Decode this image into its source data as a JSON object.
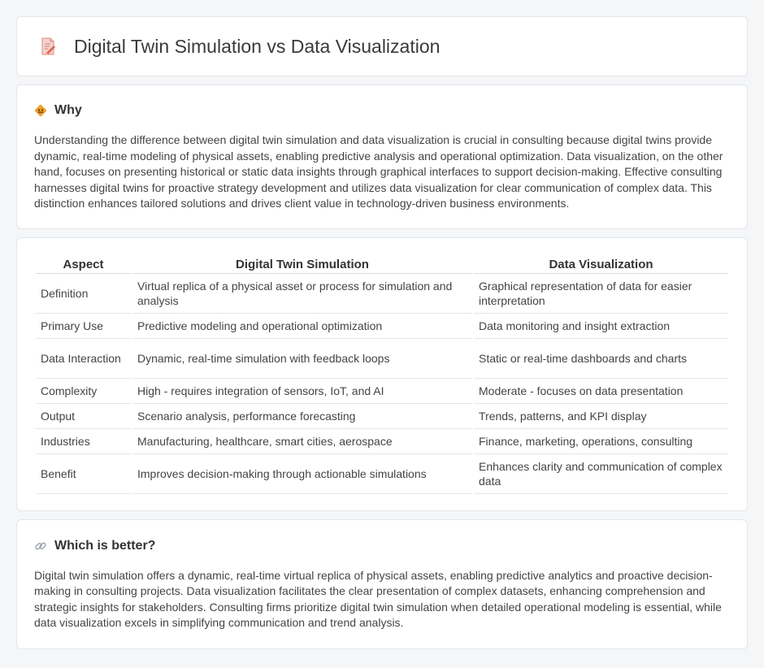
{
  "header": {
    "title": "Digital Twin Simulation vs Data Visualization",
    "icon": "document-pencil-icon"
  },
  "why": {
    "heading": "Why",
    "icon": "diamond-sign-icon",
    "text": "Understanding the difference between digital twin simulation and data visualization is crucial in consulting because digital twins provide dynamic, real-time modeling of physical assets, enabling predictive analysis and operational optimization. Data visualization, on the other hand, focuses on presenting historical or static data insights through graphical interfaces to support decision-making. Effective consulting harnesses digital twins for proactive strategy development and utilizes data visualization for clear communication of complex data. This distinction enhances tailored solutions and drives client value in technology-driven business environments."
  },
  "table": {
    "headers": [
      "Aspect",
      "Digital Twin Simulation",
      "Data Visualization"
    ],
    "rows": [
      [
        "Definition",
        "Virtual replica of a physical asset or process for simulation and analysis",
        "Graphical representation of data for easier interpretation"
      ],
      [
        "Primary Use",
        "Predictive modeling and operational optimization",
        "Data monitoring and insight extraction"
      ],
      [
        "Data Interaction",
        "Dynamic, real-time simulation with feedback loops",
        "Static or real-time dashboards and charts"
      ],
      [
        "Complexity",
        "High - requires integration of sensors, IoT, and AI",
        "Moderate - focuses on data presentation"
      ],
      [
        "Output",
        "Scenario analysis, performance forecasting",
        "Trends, patterns, and KPI display"
      ],
      [
        "Industries",
        "Manufacturing, healthcare, smart cities, aerospace",
        "Finance, marketing, operations, consulting"
      ],
      [
        "Benefit",
        "Improves decision-making through actionable simulations",
        "Enhances clarity and communication of complex data"
      ]
    ]
  },
  "better": {
    "heading": "Which is better?",
    "icon": "link-icon",
    "text": "Digital twin simulation offers a dynamic, real-time virtual replica of physical assets, enabling predictive analytics and proactive decision-making in consulting projects. Data visualization facilitates the clear presentation of complex datasets, enhancing comprehension and strategic insights for stakeholders. Consulting firms prioritize digital twin simulation when detailed operational modeling is essential, while data visualization excels in simplifying communication and trend analysis."
  },
  "colors": {
    "background": "#f5f6f8",
    "card": "#ffffff",
    "border": "#e3e6ea",
    "icon_accent": "#f0a030"
  }
}
